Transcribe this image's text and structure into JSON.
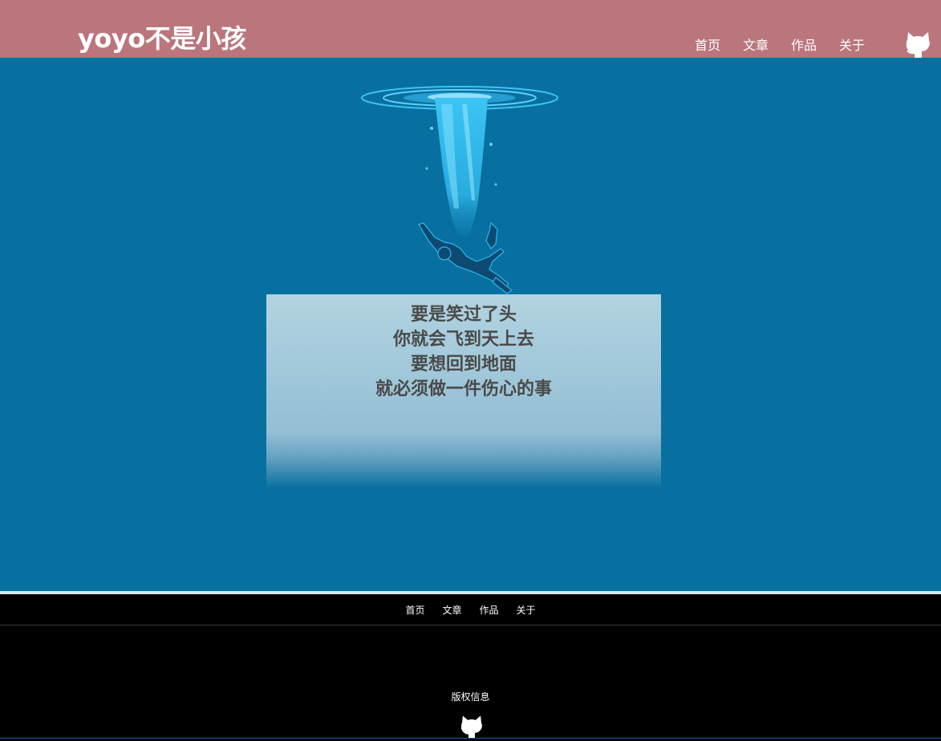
{
  "header": {
    "site_title": "yoyo不是小孩",
    "nav": [
      "首页",
      "文章",
      "作品",
      "关于"
    ],
    "github_icon": "github-octocat-icon",
    "background_color": "#bb757c"
  },
  "hero": {
    "background_color": "#0770a0",
    "illustration": "diver-falling-into-water",
    "quote_lines": [
      "要是笑过了头",
      "你就会飞到天上去",
      "要想回到地面",
      "就必须做一件伤心的事"
    ]
  },
  "footer": {
    "nav": [
      "首页",
      "文章",
      "作品",
      "关于"
    ],
    "copyright": "版权信息",
    "github_icon": "github-octocat-icon"
  }
}
